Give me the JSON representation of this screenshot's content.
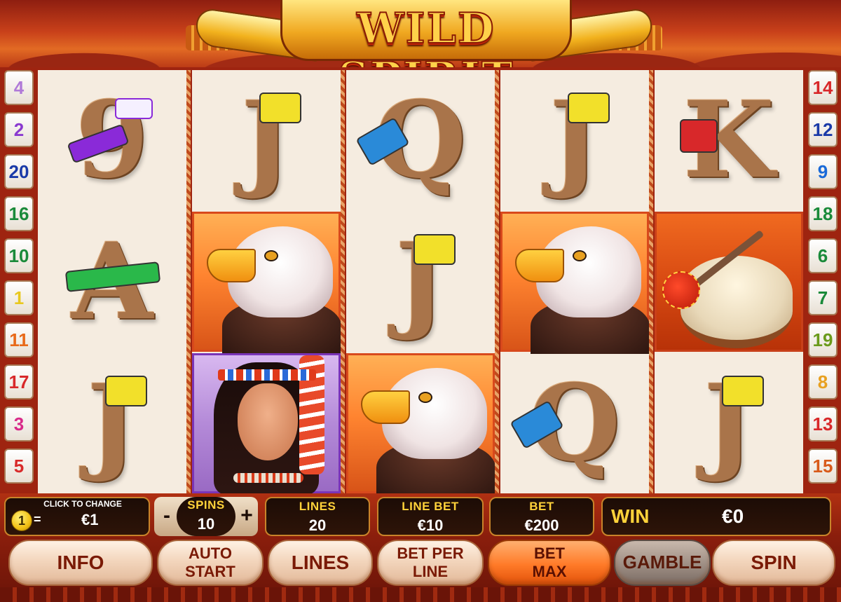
{
  "title": "WILD SPIRIT",
  "paylines_left": [
    "4",
    "2",
    "20",
    "16",
    "10",
    "1",
    "11",
    "17",
    "3",
    "5"
  ],
  "paylines_right": [
    "14",
    "12",
    "9",
    "18",
    "6",
    "7",
    "19",
    "8",
    "13",
    "15"
  ],
  "payline_colors_left": [
    "#b07ad8",
    "#8a3ad0",
    "#1a3aa8",
    "#1a8a3a",
    "#1a8a3a",
    "#e8c820",
    "#e86a1a",
    "#d8282a",
    "#d82a8a",
    "#d82a2a"
  ],
  "payline_colors_right": [
    "#d8282a",
    "#1a3aa8",
    "#1a6ad8",
    "#1a8a3a",
    "#1a8a3a",
    "#1a8a3a",
    "#6a9a1a",
    "#e8a020",
    "#d8282a",
    "#d85a1a"
  ],
  "reels": [
    [
      "9",
      "A",
      "J"
    ],
    [
      "J",
      "eagle",
      "woman"
    ],
    [
      "Q",
      "J",
      "eagle"
    ],
    [
      "J",
      "eagle",
      "Q"
    ],
    [
      "K",
      "drum",
      "J"
    ]
  ],
  "controls": {
    "click_to_change": "CLICK TO CHANGE",
    "coin": "1",
    "equals": "=",
    "coin_value": "€1",
    "spins_label": "SPINS",
    "spins_value": "10",
    "minus": "-",
    "plus": "+",
    "lines_label": "LINES",
    "lines_value": "20",
    "line_bet_label": "LINE BET",
    "line_bet_value": "€10",
    "bet_label": "BET",
    "bet_value": "€200",
    "win_label": "WIN",
    "win_value": "€0"
  },
  "buttons": {
    "info": "INFO",
    "auto_start_1": "AUTO",
    "auto_start_2": "START",
    "lines": "LINES",
    "bet_per_line_1": "BET PER",
    "bet_per_line_2": "LINE",
    "bet_max_1": "BET",
    "bet_max_2": "MAX",
    "gamble": "GAMBLE",
    "spin": "SPIN"
  },
  "colors": {
    "band_purple": "#8a2ad8",
    "band_yellow": "#f2e02a",
    "band_blue": "#2a8ad8",
    "band_green": "#2ab84a",
    "band_red": "#d8282a"
  }
}
